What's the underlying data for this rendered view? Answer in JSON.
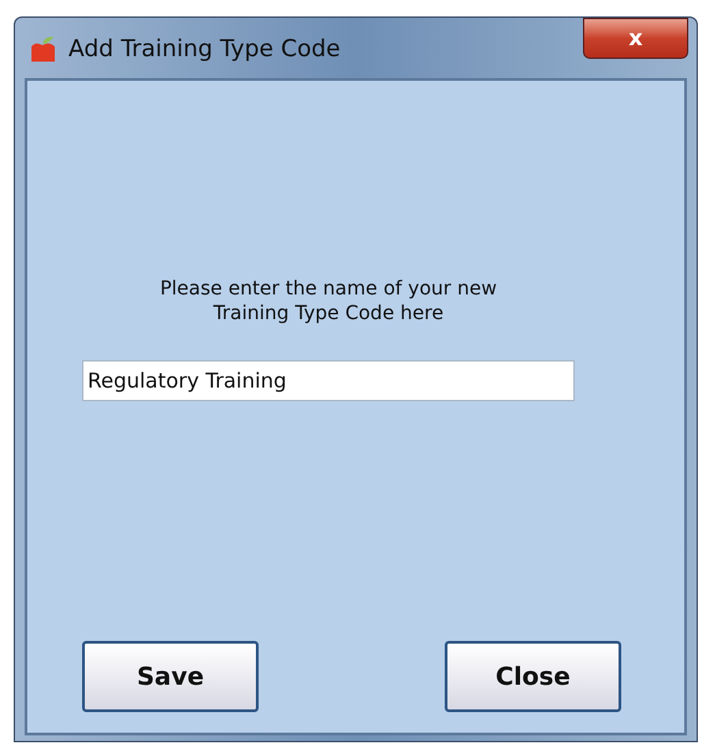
{
  "window": {
    "title": "Add Training Type Code",
    "close_button": "x"
  },
  "prompt": {
    "lines": [
      "Please enter the name of your new",
      "Training Type Code here"
    ]
  },
  "name_field": {
    "value": "Regulatory Training"
  },
  "buttons": [
    "Save",
    "Close"
  ]
}
